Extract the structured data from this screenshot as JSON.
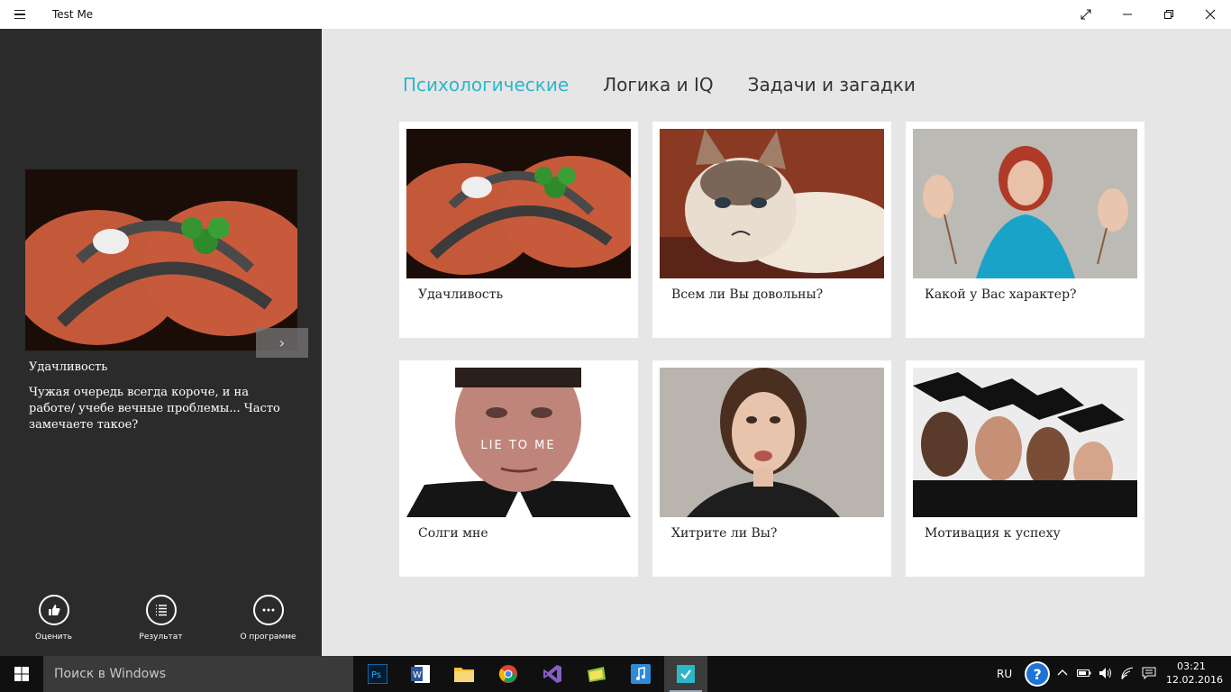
{
  "window": {
    "title": "Test Me",
    "controls": [
      "fullscreen-icon",
      "minimize-icon",
      "restore-icon",
      "close-icon"
    ]
  },
  "sidebar": {
    "featured": {
      "title": "Удачливость",
      "description": "Чужая очередь всегда короче, и на работе/ учебе вечные проблемы... Часто замечаете такое?",
      "next_icon": "›"
    },
    "actions": [
      {
        "label": "Оценить",
        "icon": "thumbs-up-icon"
      },
      {
        "label": "Результат",
        "icon": "list-icon"
      },
      {
        "label": "О программе",
        "icon": "more-icon"
      }
    ]
  },
  "main": {
    "tabs": [
      {
        "label": "Психологические",
        "active": true
      },
      {
        "label": "Логика и IQ",
        "active": false
      },
      {
        "label": "Задачи и загадки",
        "active": false
      }
    ],
    "cards": [
      {
        "label": "Удачливость",
        "image": "hands-horseshoe-clover"
      },
      {
        "label": "Всем ли Вы довольны?",
        "image": "grumpy-cat"
      },
      {
        "label": "Какой у Вас характер?",
        "image": "woman-with-masks"
      },
      {
        "label": "Солги мне",
        "image": "lie-to-me-man",
        "image_text": "LIE TO ME"
      },
      {
        "label": "Хитрите ли Вы?",
        "image": "woman-thinking"
      },
      {
        "label": "Мотивация к успеху",
        "image": "graduates"
      }
    ]
  },
  "taskbar": {
    "search_placeholder": "Поиск в Windows",
    "apps": [
      "photoshop-icon",
      "word-icon",
      "file-explorer-icon",
      "chrome-icon",
      "visual-studio-icon",
      "notes-icon",
      "music-app-icon",
      "test-me-icon"
    ],
    "tray": {
      "language": "RU",
      "time": "03:21",
      "date": "12.02.2016"
    }
  },
  "colors": {
    "accent": "#2bb7c8",
    "sidebar_bg": "#2b2b2b",
    "main_bg": "#e6e6e6",
    "taskbar_bg": "#101010"
  }
}
